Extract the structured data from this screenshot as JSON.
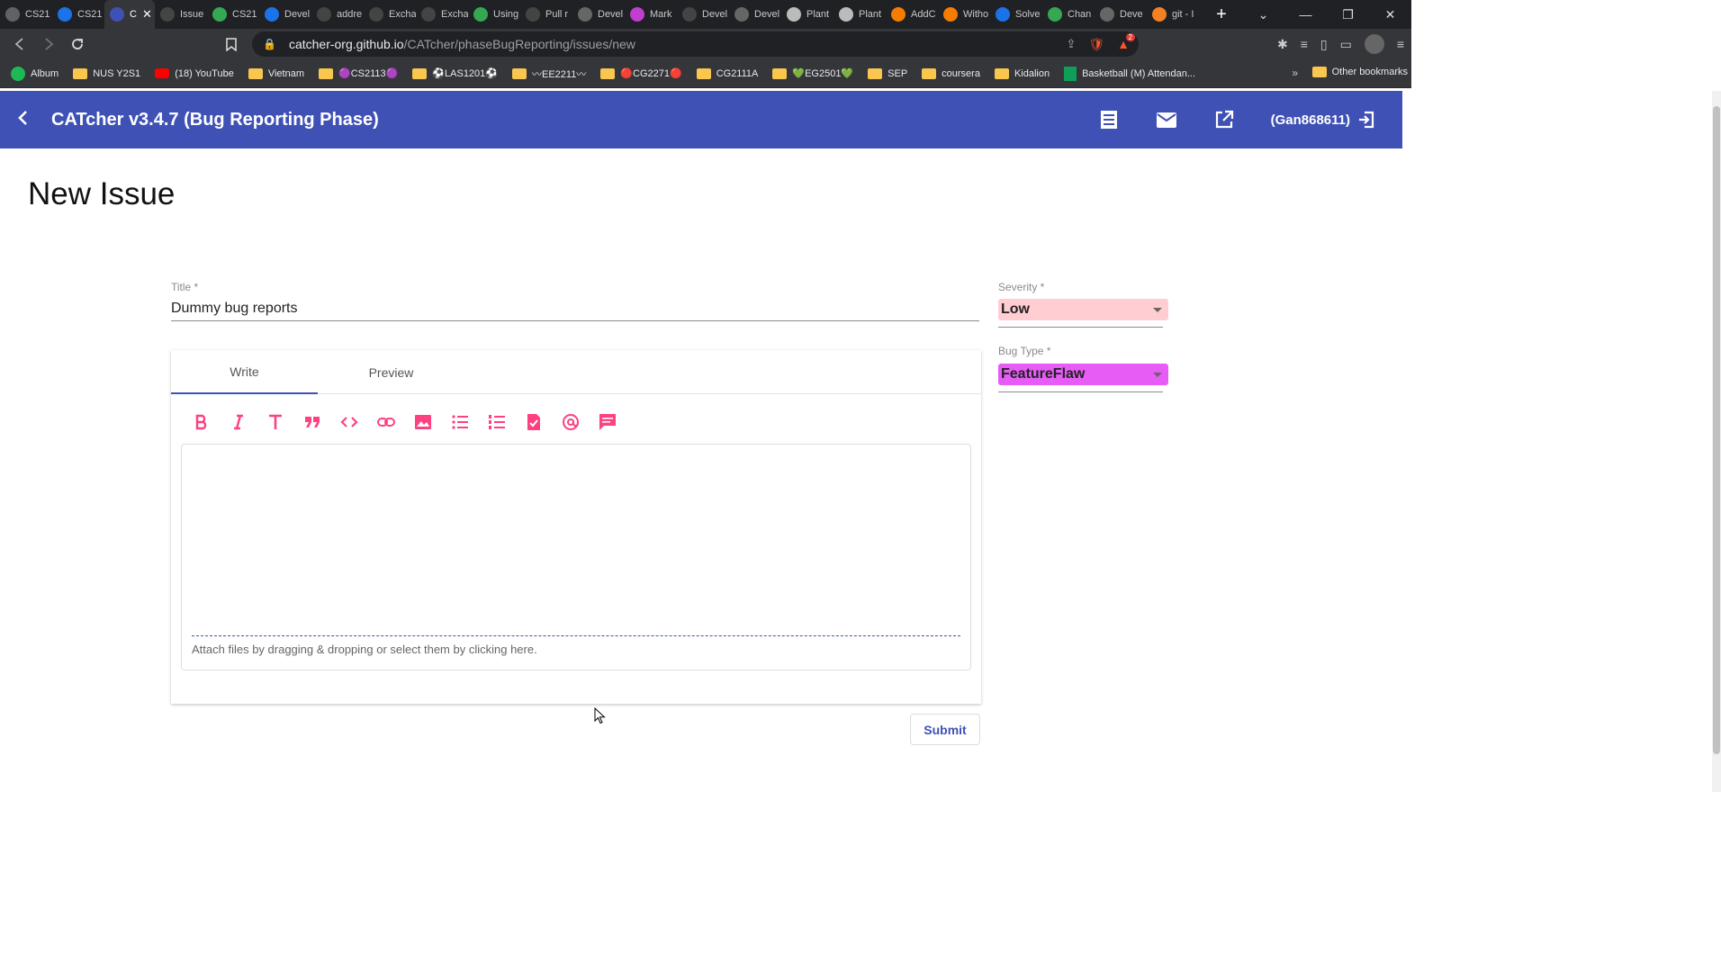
{
  "browser": {
    "tabs": [
      {
        "label": "CS21",
        "icon": "github-icon",
        "color": "#5f6368"
      },
      {
        "label": "CS21",
        "icon": "graduation-cap-icon",
        "color": "#1a73e8"
      },
      {
        "label": "C",
        "icon": "catcher-icon",
        "color": "#3f51b5",
        "active": true
      },
      {
        "label": "Issue",
        "icon": "github-icon",
        "color": "#444"
      },
      {
        "label": "CS21",
        "icon": "grid-icon",
        "color": "#34a853"
      },
      {
        "label": "Devel",
        "icon": "se-edu-icon",
        "color": "#1a73e8"
      },
      {
        "label": "addre",
        "icon": "github-icon",
        "color": "#444"
      },
      {
        "label": "Excha",
        "icon": "github-icon",
        "color": "#444"
      },
      {
        "label": "Excha",
        "icon": "github-icon",
        "color": "#444"
      },
      {
        "label": "Using",
        "icon": "book-icon",
        "color": "#34a853"
      },
      {
        "label": "Pull r",
        "icon": "github-icon",
        "color": "#444"
      },
      {
        "label": "Devel",
        "icon": "globe-icon",
        "color": "#666"
      },
      {
        "label": "Mark",
        "icon": "circle-icon",
        "color": "#c03fd1"
      },
      {
        "label": "Devel",
        "icon": "github-icon",
        "color": "#444"
      },
      {
        "label": "Devel",
        "icon": "globe-icon",
        "color": "#666"
      },
      {
        "label": "Plant",
        "icon": "plantuml-icon",
        "color": "#bbb"
      },
      {
        "label": "Plant",
        "icon": "plantuml-icon",
        "color": "#bbb"
      },
      {
        "label": "AddC",
        "icon": "sourcetree-icon",
        "color": "#f57c00"
      },
      {
        "label": "Witho",
        "icon": "sourcetree-icon",
        "color": "#f57c00"
      },
      {
        "label": "Solve",
        "icon": "atlassian-icon",
        "color": "#1a73e8"
      },
      {
        "label": "Chan",
        "icon": "git-icon",
        "color": "#34a853"
      },
      {
        "label": "Deve",
        "icon": "globe-icon",
        "color": "#666"
      },
      {
        "label": "git - I",
        "icon": "stackoverflow-icon",
        "color": "#f48024"
      }
    ],
    "url_host": "catcher-org.github.io",
    "url_path": "/CATcher/phaseBugReporting/issues/new",
    "brave_badge": "2",
    "bookmarks": [
      {
        "label": "Album",
        "type": "spotify"
      },
      {
        "label": "NUS Y2S1",
        "type": "folder"
      },
      {
        "label": "(18) YouTube",
        "type": "youtube"
      },
      {
        "label": "Vietnam",
        "type": "folder"
      },
      {
        "label": "🟣CS2113🟣",
        "type": "folder"
      },
      {
        "label": "⚽LAS1201⚽",
        "type": "folder"
      },
      {
        "label": "〰EE2211〰",
        "type": "folder"
      },
      {
        "label": "🔴CG2271🔴",
        "type": "folder"
      },
      {
        "label": "CG2111A",
        "type": "folder"
      },
      {
        "label": "💚EG2501💚",
        "type": "folder"
      },
      {
        "label": "SEP",
        "type": "folder"
      },
      {
        "label": "coursera",
        "type": "folder"
      },
      {
        "label": "Kidalion",
        "type": "folder"
      },
      {
        "label": "Basketball (M) Attendan...",
        "type": "sheet"
      }
    ],
    "other_bookmarks": "Other bookmarks",
    "more_bookmarks": "»"
  },
  "app": {
    "title": "CATcher v3.4.7  (Bug Reporting Phase)",
    "user": "(Gan868611)",
    "primary_color": "#3f51b5",
    "accent_color": "#ff4081"
  },
  "page": {
    "heading": "New Issue",
    "title_label": "Title *",
    "title_value": "Dummy bug reports",
    "tabs": [
      "Write",
      "Preview"
    ],
    "attach_text": "Attach files by dragging & dropping or select them by clicking here.",
    "submit_label": "Submit",
    "severity": {
      "label": "Severity *",
      "value": "Low",
      "color": "#ffcdd2"
    },
    "bug_type": {
      "label": "Bug Type *",
      "value": "FeatureFlaw",
      "color": "#e65cf5"
    }
  },
  "toolbar_icons": [
    "bold-icon",
    "italic-icon",
    "heading-icon",
    "quote-icon",
    "code-icon",
    "link-icon",
    "image-icon",
    "bullet-list-icon",
    "numbered-list-icon",
    "task-list-icon",
    "mention-icon",
    "saved-reply-icon"
  ]
}
